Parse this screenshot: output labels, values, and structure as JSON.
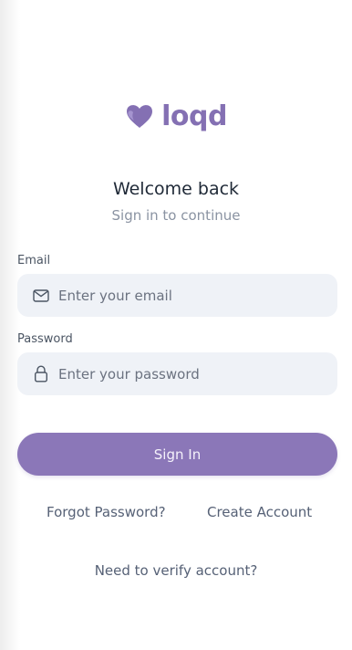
{
  "brand": {
    "name": "loqd",
    "logo_icon": "heart-logo-icon",
    "color": "#8470b3"
  },
  "header": {
    "title": "Welcome back",
    "subtitle": "Sign in to continue"
  },
  "form": {
    "email": {
      "label": "Email",
      "placeholder": "Enter your email",
      "value": "",
      "icon": "mail-icon"
    },
    "password": {
      "label": "Password",
      "placeholder": "Enter your password",
      "value": "",
      "icon": "lock-icon"
    },
    "submit_label": "Sign In",
    "submit_color": "#8b77b8",
    "field_background": "#eff2f7"
  },
  "links": {
    "forgot_password": "Forgot Password?",
    "create_account": "Create Account",
    "verify_account": "Need to verify account?"
  }
}
